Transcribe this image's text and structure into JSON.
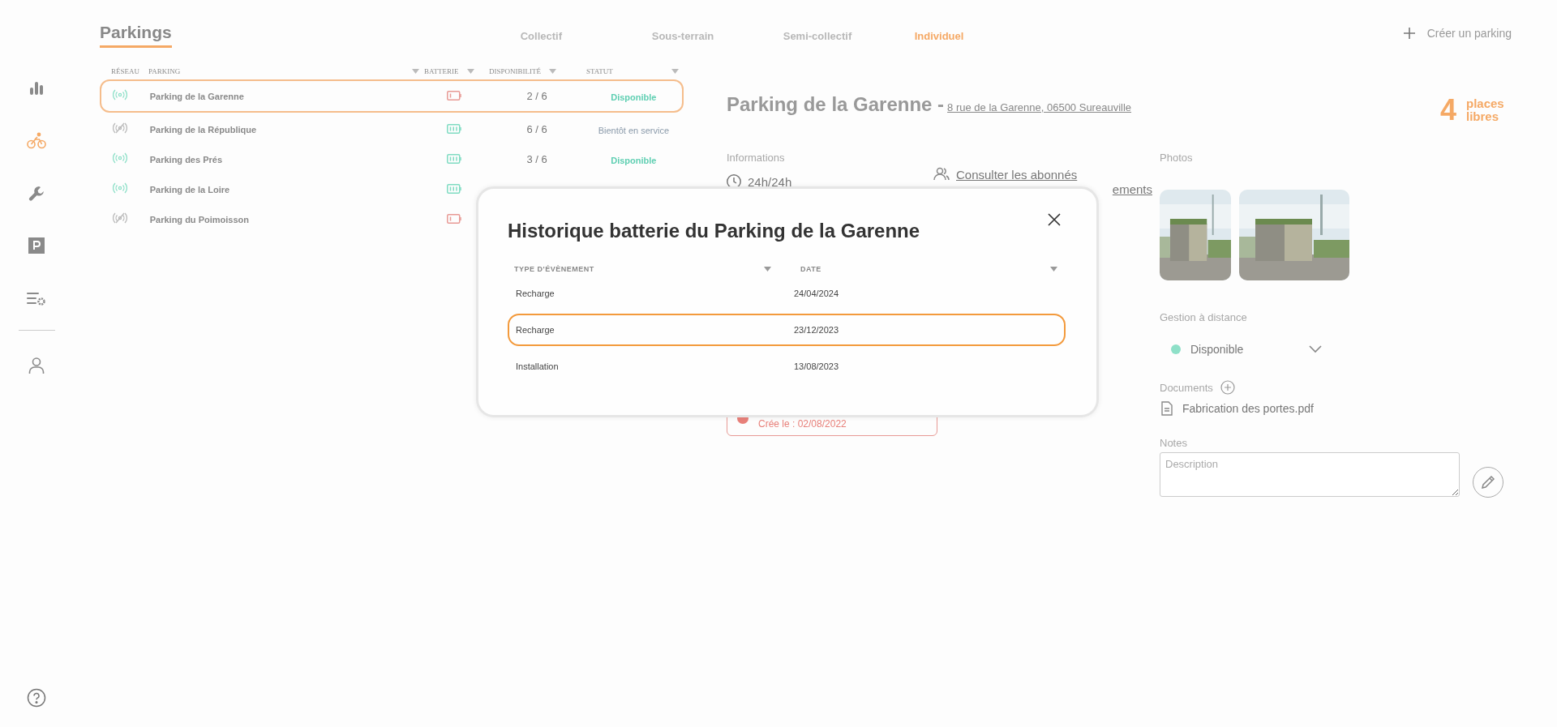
{
  "sidebar": {
    "items": [
      {
        "kind": "chart",
        "selected": false
      },
      {
        "kind": "bike",
        "selected": true
      },
      {
        "kind": "wrench",
        "selected": false
      },
      {
        "kind": "parking",
        "selected": false
      },
      {
        "kind": "list-settings",
        "selected": false
      },
      {
        "kind": "user",
        "selected": false
      }
    ]
  },
  "header": {
    "title": "Parkings",
    "tabs": [
      {
        "label": "Collectif",
        "selected": false
      },
      {
        "label": "Sous-terrain",
        "selected": false
      },
      {
        "label": "Semi-collectif",
        "selected": false
      },
      {
        "label": "Individuel",
        "selected": true
      }
    ],
    "create_button": "Créer un parking"
  },
  "table": {
    "columns": [
      {
        "label": "RÉSEAU",
        "sortable": false
      },
      {
        "label": "PARKING",
        "sortable": true
      },
      {
        "label": "BATTERIE",
        "sortable": true
      },
      {
        "label": "DISPONIBILITÉ",
        "sortable": true
      },
      {
        "label": "STATUT",
        "sortable": true
      }
    ],
    "rows": [
      {
        "network": true,
        "name": "Parking de la Garenne",
        "battery": {
          "kind": "low"
        },
        "availability": "2 / 6",
        "status": {
          "label": "Disponible",
          "kind": "available"
        },
        "selected": true
      },
      {
        "network": false,
        "name": "Parking de la République",
        "battery": {
          "kind": "full"
        },
        "availability": "6 / 6",
        "status": {
          "label": "Bientôt en service",
          "kind": "soon"
        },
        "selected": false
      },
      {
        "network": true,
        "name": "Parking des Prés",
        "battery": {
          "kind": "full"
        },
        "availability": "3 / 6",
        "status": {
          "label": "Disponible",
          "kind": "available"
        },
        "selected": false
      },
      {
        "network": true,
        "name": "Parking de la Loire",
        "battery": {
          "kind": "full"
        },
        "selected": false
      },
      {
        "network": false,
        "name": "Parking du Poimoisson",
        "battery": {
          "kind": "low"
        },
        "selected": false
      }
    ]
  },
  "detail": {
    "title": "Parking de la Garenne -",
    "address": "8 rue de la Garenne, 06500 Sureauville",
    "free_count": "4",
    "free_label": "places libres",
    "informations": {
      "label": "Informations",
      "hours": "24h/24h",
      "subscribers_link": "Consulter les abonnés",
      "second_link": "ements"
    },
    "alert_card": {
      "date": "Crée le : 02/08/2022"
    },
    "photos": {
      "label": "Photos"
    },
    "remote": {
      "label": "Gestion à distance",
      "status": "Disponible",
      "color": "#8ee0c8"
    },
    "documents": {
      "label": "Documents",
      "files": [
        "Fabrication des portes.pdf"
      ]
    },
    "notes": {
      "label": "Notes",
      "placeholder": "Description"
    }
  },
  "modal": {
    "title": "Historique batterie du Parking de la Garenne",
    "columns": [
      "TYPE D'ÉVÈNEMENT",
      "DATE"
    ],
    "rows": [
      {
        "type": "Recharge",
        "date": "24/04/2024",
        "selected": false
      },
      {
        "type": "Recharge",
        "date": "23/12/2023",
        "selected": true
      },
      {
        "type": "Installation",
        "date": "13/08/2023",
        "selected": false
      }
    ]
  }
}
